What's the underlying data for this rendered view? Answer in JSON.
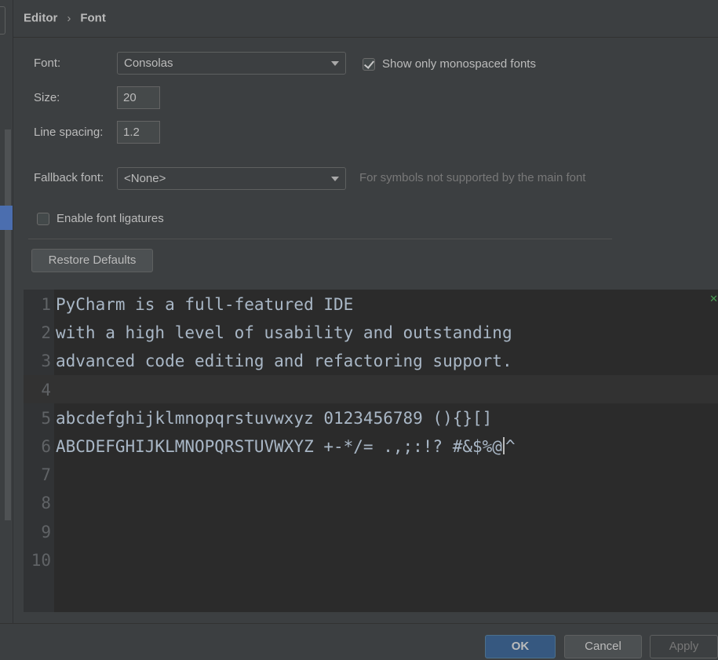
{
  "breadcrumb": {
    "parent": "Editor",
    "separator": "›",
    "current": "Font"
  },
  "font": {
    "label": "Font:",
    "selected": "Consolas",
    "show_mono_label": "Show only monospaced fonts",
    "show_mono_checked": true
  },
  "size": {
    "label": "Size:",
    "value": "20"
  },
  "line_spacing": {
    "label": "Line spacing:",
    "value": "1.2"
  },
  "fallback": {
    "label": "Fallback font:",
    "selected": "<None>",
    "hint": "For symbols not supported by the main font"
  },
  "ligatures": {
    "label": "Enable font ligatures",
    "checked": false
  },
  "restore_defaults": "Restore Defaults",
  "preview": {
    "line_numbers": [
      "1",
      "2",
      "3",
      "4",
      "5",
      "6",
      "7",
      "8",
      "9",
      "10"
    ],
    "lines": [
      "PyCharm is a full-featured IDE",
      "with a high level of usability and outstanding",
      "advanced code editing and refactoring support.",
      "",
      "abcdefghijklmnopqrstuvwxyz 0123456789 (){}[]",
      "ABCDEFGHIJKLMNOPQRSTUVWXYZ +-*/= .,;:!? #&$%@",
      "",
      "",
      "",
      ""
    ],
    "line6_tail": "^",
    "inspection_icon": "✕"
  },
  "footer": {
    "ok": "OK",
    "cancel": "Cancel",
    "apply": "Apply"
  },
  "colors": {
    "background": "#3c3f41",
    "editor": "#2b2b2b",
    "accent": "#365880",
    "selection": "#4b6eaf"
  }
}
